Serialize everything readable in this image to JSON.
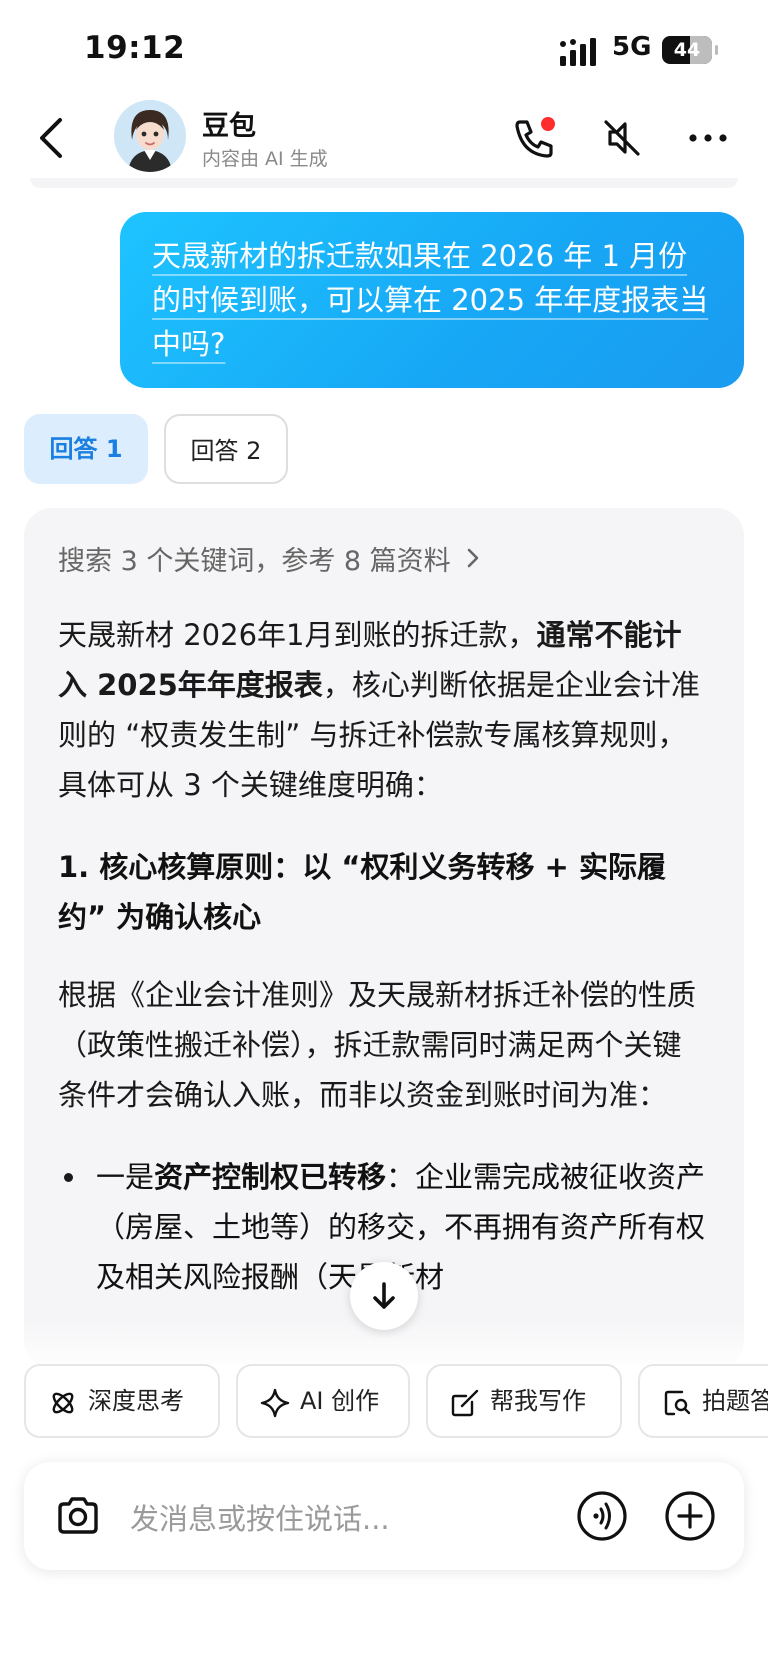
{
  "status_bar": {
    "time": "19:12",
    "network": "5G",
    "battery": "44"
  },
  "header": {
    "bot_name": "豆包",
    "subtitle": "内容由 AI 生成"
  },
  "user_message": {
    "text": "天晟新材的拆迁款如果在 2026 年 1 月份的时候到账，可以算在 2025 年年度报表当中吗?"
  },
  "answer_tabs": [
    "回答 1",
    "回答 2"
  ],
  "answer": {
    "search_summary": "搜索 3 个关键词，参考 8 篇资料",
    "intro_pre": "天晟新材 2026年1月到账的拆迁款，",
    "intro_bold": "通常不能计入 2025年年度报表",
    "intro_post": "，核心判断依据是企业会计准则的 “权责发生制” 与拆迁补偿款专属核算规则，具体可从 3 个关键维度明确：",
    "heading_1": "1. 核心核算原则：以 “权利义务转移 + 实际履约” 为确认核心",
    "para_2": "根据《企业会计准则》及天晟新材拆迁补偿的性质（政策性搬迁补偿），拆迁款需同时满足两个关键条件才会确认入账，而非以资金到账时间为准：",
    "bullet_1_pre": "一是",
    "bullet_1_bold": "资产控制权已转移",
    "bullet_1_post": "：企业需完成被征收资产（房屋、土地等）的移交，不再拥有资产所有权及相关风险报酬（天晟新材"
  },
  "quick_actions": [
    "深度思考",
    "AI 创作",
    "帮我写作",
    "拍题答疑"
  ],
  "input": {
    "placeholder": "发消息或按住说话..."
  },
  "colors": {
    "accent": "#1a9bf0",
    "tab_active_bg": "#dcedfd",
    "card_bg": "#f5f5f7"
  }
}
